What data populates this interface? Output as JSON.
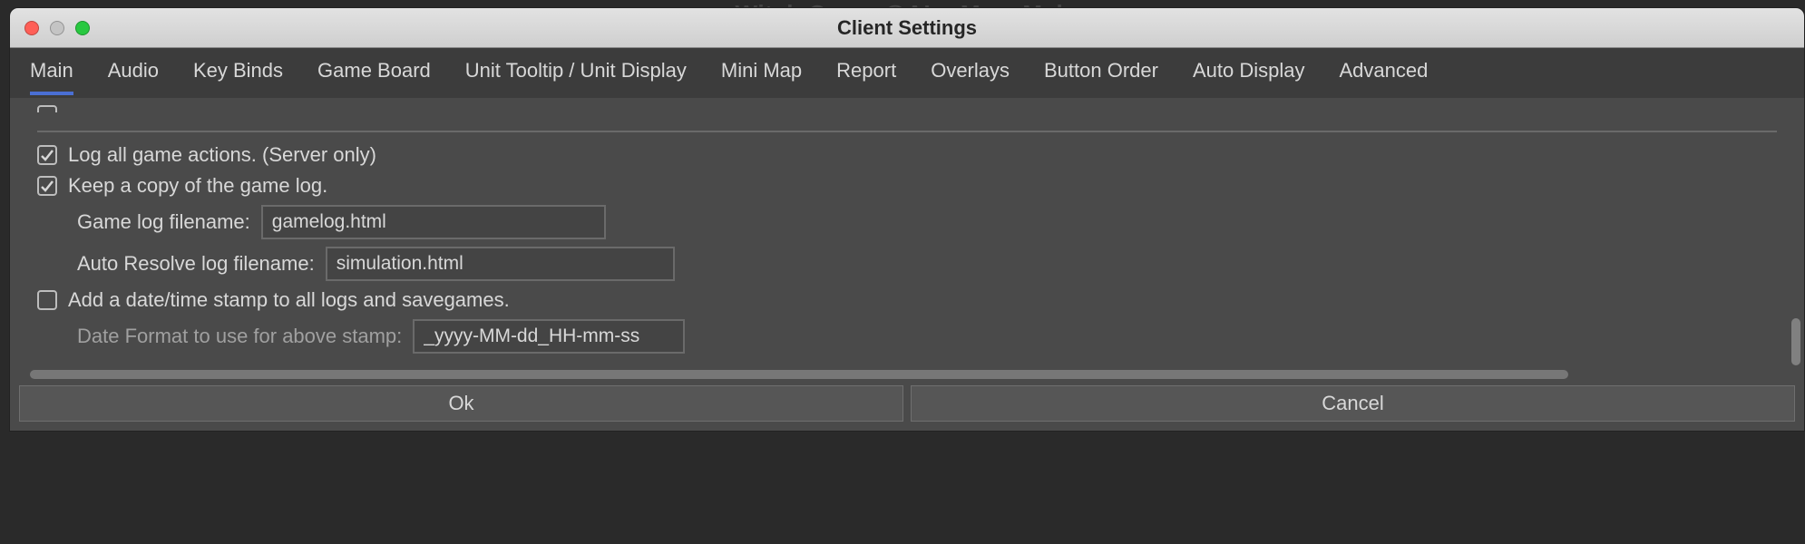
{
  "background_app_title": "Witch Coven@AL - MegaMek",
  "dialog": {
    "title": "Client Settings",
    "tabs": [
      "Main",
      "Audio",
      "Key Binds",
      "Game Board",
      "Unit Tooltip / Unit Display",
      "Mini Map",
      "Report",
      "Overlays",
      "Button Order",
      "Auto Display",
      "Advanced"
    ],
    "activeTabIndex": 0,
    "options": {
      "logAllActions": {
        "label": "Log all game actions. (Server only)",
        "checked": true
      },
      "keepCopy": {
        "label": "Keep a copy of the game log.",
        "checked": true
      },
      "gameLogFilename": {
        "label": "Game log filename:",
        "value": "gamelog.html"
      },
      "autoResolveLogFilename": {
        "label": "Auto Resolve log filename:",
        "value": "simulation.html"
      },
      "addTimestamp": {
        "label": "Add a date/time stamp to all logs and savegames.",
        "checked": false
      },
      "dateFormat": {
        "label": "Date Format to use for above stamp:",
        "value": "_yyyy-MM-dd_HH-mm-ss"
      }
    },
    "buttons": {
      "ok": "Ok",
      "cancel": "Cancel"
    }
  }
}
